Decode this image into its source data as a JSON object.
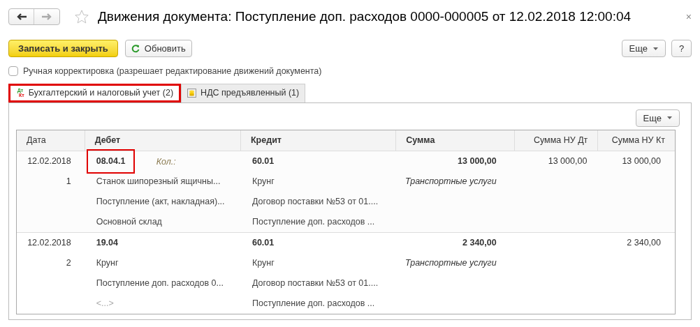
{
  "window": {
    "title": "Движения документа: Поступление доп. расходов 0000-000005 от 12.02.2018 12:00:04",
    "close": "×"
  },
  "toolbar": {
    "primary": "Записать и закрыть",
    "refresh": "Обновить",
    "more": "Еще",
    "help": "?"
  },
  "manual_edit": {
    "label": "Ручная корректировка (разрешает редактирование движений документа)",
    "checked": false
  },
  "tabs": [
    {
      "kind": "accounting",
      "label": "Бухгалтерский и налоговый учет (2)",
      "selected": true,
      "highlighted": true,
      "icon_top": "Дт",
      "icon_bottom": "Кт"
    },
    {
      "kind": "vat",
      "label": "НДС предъявленный (1)",
      "selected": false,
      "highlighted": false
    }
  ],
  "table_more": "Еще",
  "table": {
    "columns": [
      "Дата",
      "Дебет",
      "Кредит",
      "Сумма",
      "Сумма НУ Дт",
      "Сумма НУ Кт"
    ],
    "rows": [
      {
        "date": "12.02.2018",
        "number": "1",
        "debit": [
          {
            "kind": "account",
            "text": "08.04.1",
            "highlighted": true
          },
          {
            "kind": "text",
            "text": "Станок шипорезный ящичны..."
          },
          {
            "kind": "text",
            "text": "Поступление (акт, накладная)..."
          },
          {
            "kind": "text",
            "text": "Основной склад"
          }
        ],
        "debit_qty": "Кол.:",
        "credit": [
          {
            "kind": "account",
            "text": "60.01"
          },
          {
            "kind": "text",
            "text": "Крунг"
          },
          {
            "kind": "text",
            "text": "Договор поставки №53 от 01...."
          },
          {
            "kind": "text",
            "text": "Поступление доп. расходов ..."
          }
        ],
        "sum": "13 000,00",
        "sum_note": "Транспортные услуги",
        "nu_dt": "13 000,00",
        "nu_kt": "13 000,00"
      },
      {
        "date": "12.02.2018",
        "number": "2",
        "debit": [
          {
            "kind": "account",
            "text": "19.04",
            "highlighted": false
          },
          {
            "kind": "text",
            "text": "Крунг"
          },
          {
            "kind": "text",
            "text": "Поступление доп. расходов 0..."
          },
          {
            "kind": "empty",
            "text": "<...>"
          }
        ],
        "credit": [
          {
            "kind": "account",
            "text": "60.01"
          },
          {
            "kind": "text",
            "text": "Крунг"
          },
          {
            "kind": "text",
            "text": "Договор поставки №53 от 01...."
          },
          {
            "kind": "text",
            "text": "Поступление доп. расходов ..."
          }
        ],
        "sum": "2 340,00",
        "sum_note": "Транспортные услуги",
        "nu_kt": "2 340,00"
      }
    ]
  }
}
